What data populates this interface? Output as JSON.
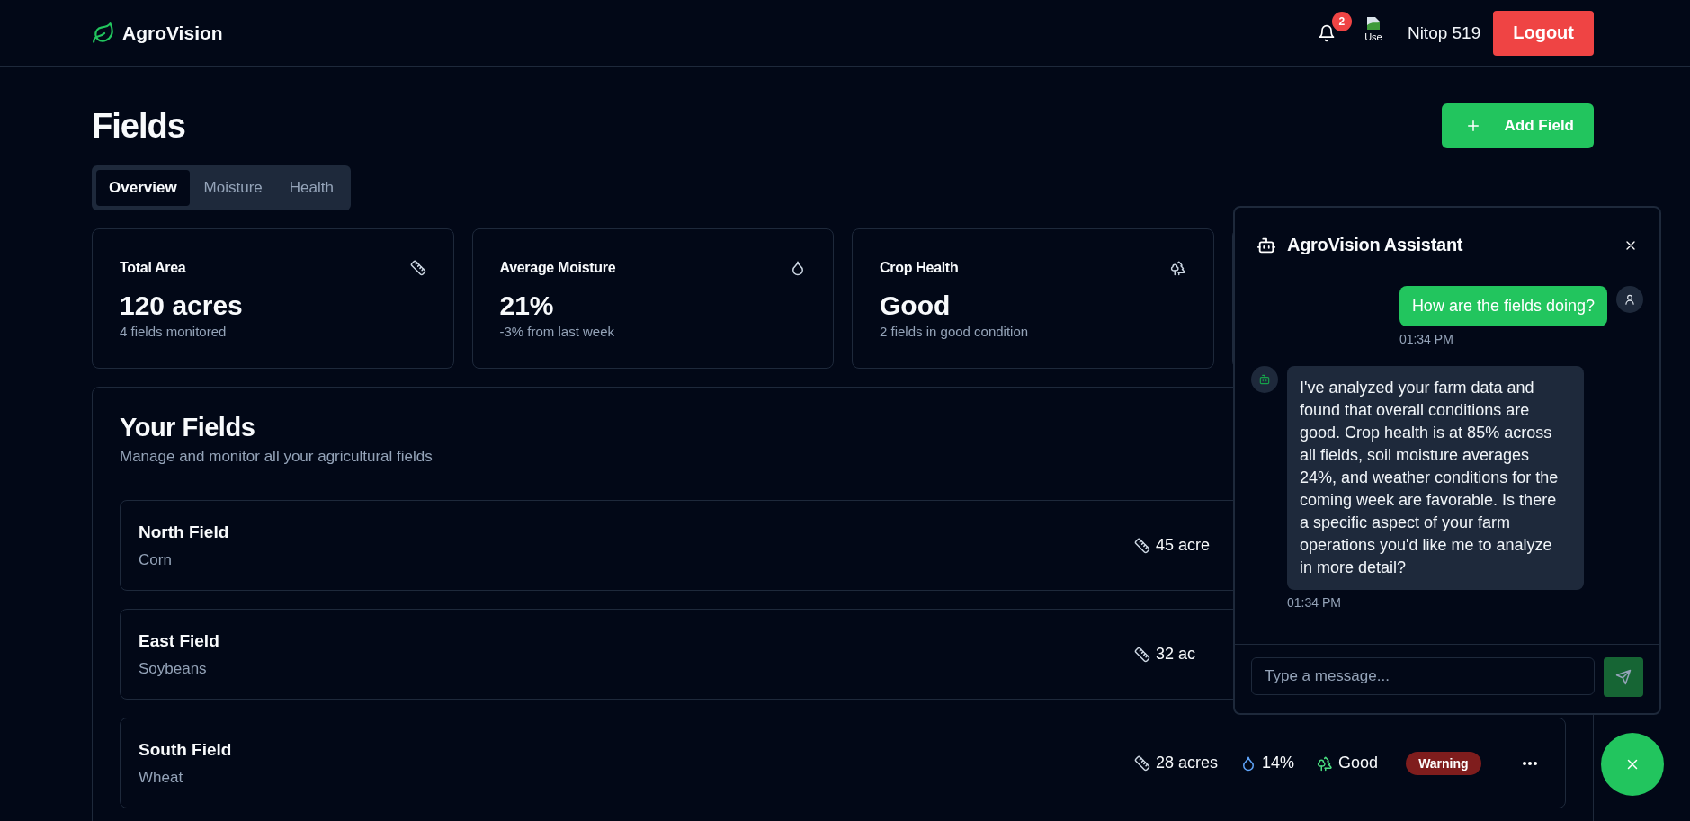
{
  "header": {
    "brand": "AgroVision",
    "notifications": {
      "count": "2"
    },
    "user": {
      "avatar_alt": "Use",
      "name": "Nitop 519"
    },
    "logout": "Logout"
  },
  "page": {
    "title": "Fields",
    "add_button": "Add Field"
  },
  "tabs": [
    {
      "label": "Overview",
      "selected": true
    },
    {
      "label": "Moisture",
      "selected": false
    },
    {
      "label": "Health",
      "selected": false
    }
  ],
  "stats": [
    {
      "label": "Total Area",
      "value": "120 acres",
      "note": "4 fields monitored",
      "kind": "area"
    },
    {
      "label": "Average Moisture",
      "value": "21%",
      "note": "-3% from last week",
      "kind": "moisture"
    },
    {
      "label": "Crop Health",
      "value": "Good",
      "note": "2 fields in good condition",
      "kind": "health"
    }
  ],
  "fields_panel": {
    "title": "Your Fields",
    "subtitle": "Manage and monitor all your agricultural fields",
    "rows": [
      {
        "name": "North Field",
        "crop": "Corn",
        "stats": [
          {
            "kind": "area",
            "text": "45 acre"
          }
        ]
      },
      {
        "name": "East Field",
        "crop": "Soybeans",
        "stats": [
          {
            "kind": "area",
            "text": "32 ac"
          }
        ]
      },
      {
        "name": "South Field",
        "crop": "Wheat",
        "stats": [
          {
            "kind": "area",
            "text": "28 acres"
          },
          {
            "kind": "moisture",
            "text": "14%"
          },
          {
            "kind": "health",
            "text": "Good"
          }
        ],
        "status": {
          "label": "Warning",
          "kind": "warning"
        },
        "menu": true
      }
    ]
  },
  "chat": {
    "title": "AgroVision Assistant",
    "messages": [
      {
        "kind": "user",
        "text": "How are the fields doing?",
        "time": "01:34 PM"
      },
      {
        "kind": "bot",
        "text": "I've analyzed your farm data and found that overall conditions are good. Crop health is at 85% across all fields, soil moisture averages 24%, and weather conditions for the coming week are favorable. Is there a specific aspect of your farm operations you'd like me to analyze in more detail?",
        "time": "01:34 PM"
      }
    ],
    "input": {
      "placeholder": "Type a message..."
    },
    "open": true
  }
}
